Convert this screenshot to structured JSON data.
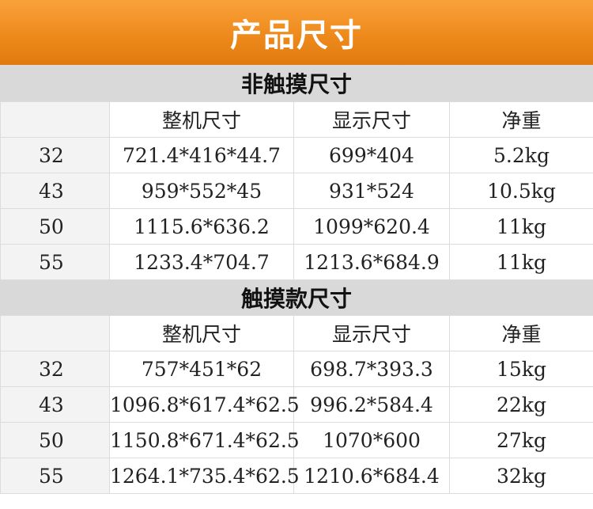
{
  "title": "产品尺寸",
  "columns": [
    "",
    "整机尺寸",
    "显示尺寸",
    "净重"
  ],
  "sections": [
    {
      "name": "非触摸尺寸",
      "rows": [
        [
          "32",
          "721.4*416*44.7",
          "699*404",
          "5.2kg"
        ],
        [
          "43",
          "959*552*45",
          "931*524",
          "10.5kg"
        ],
        [
          "50",
          "1115.6*636.2",
          "1099*620.4",
          "11kg"
        ],
        [
          "55",
          "1233.4*704.7",
          "1213.6*684.9",
          "11kg"
        ]
      ]
    },
    {
      "name": "触摸款尺寸",
      "rows": [
        [
          "32",
          "757*451*62",
          "698.7*393.3",
          "15kg"
        ],
        [
          "43",
          "1096.8*617.4*62.5",
          "996.2*584.4",
          "22kg"
        ],
        [
          "50",
          "1150.8*671.4*62.5",
          "1070*600",
          "27kg"
        ],
        [
          "55",
          "1264.1*735.4*62.5",
          "1210.6*684.4",
          "32kg"
        ]
      ]
    }
  ]
}
